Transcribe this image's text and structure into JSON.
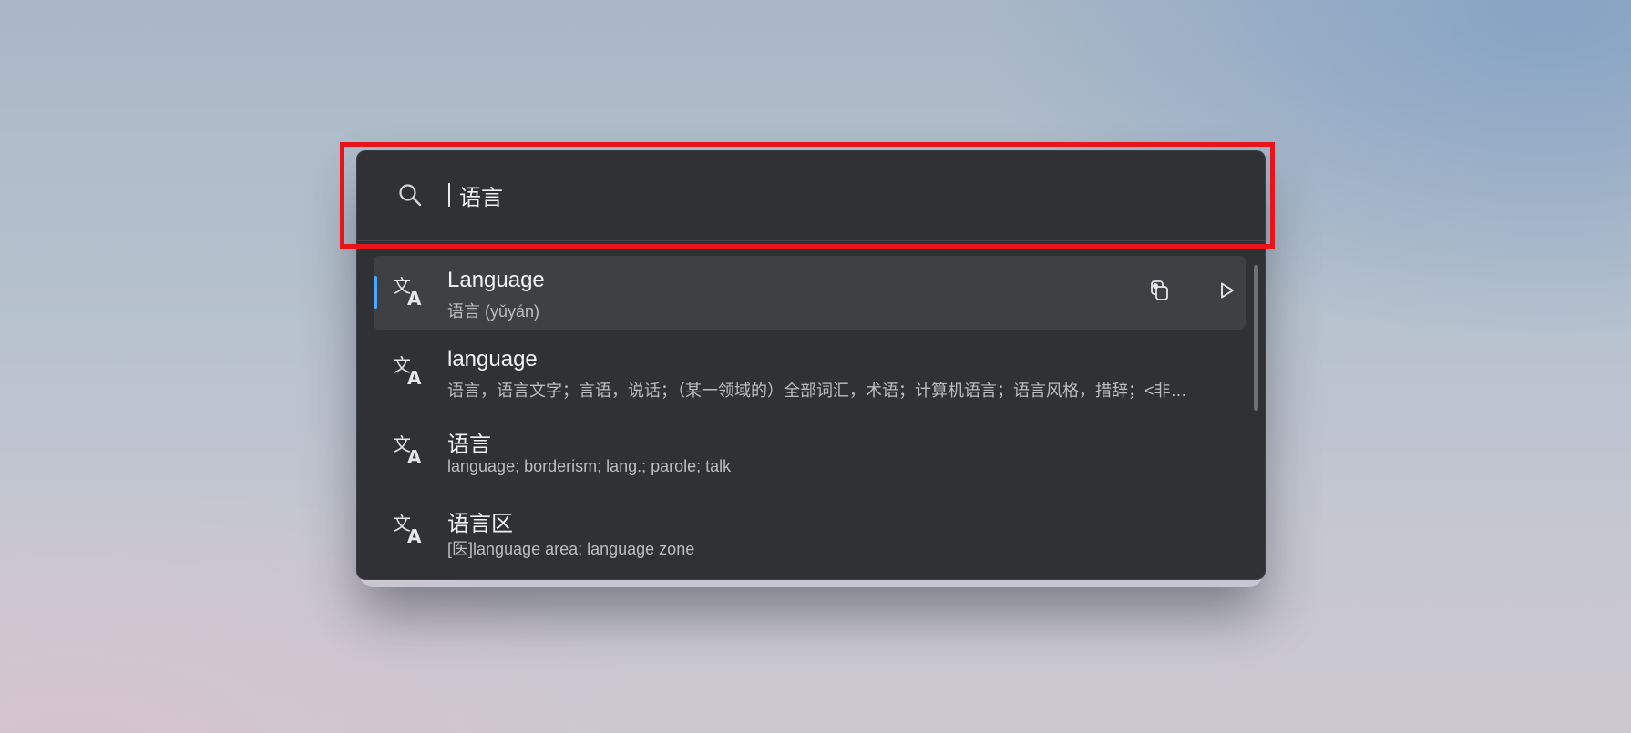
{
  "search": {
    "query": "语言",
    "icon": "search-icon"
  },
  "results": [
    {
      "icon": "translate-icon",
      "title": "Language",
      "subtitle": "语言 (yǔyán)",
      "selected": true,
      "actions": [
        "copy-icon",
        "play-icon"
      ]
    },
    {
      "icon": "translate-icon",
      "title": "language",
      "subtitle": "语言，语言文字；言语，说话；（某一领域的）全部词汇，术语；计算机语言；语言风格，措辞；<非…",
      "selected": false
    },
    {
      "icon": "translate-icon",
      "title": "语言",
      "subtitle": "language; borderism; lang.; parole; talk",
      "selected": false
    },
    {
      "icon": "translate-icon",
      "title": "语言区",
      "subtitle": "[医]language area; language zone",
      "selected": false
    }
  ],
  "colors": {
    "panel_bg": "#2f3134",
    "selected_bg": "#3e4044",
    "accent": "#4aa8ff",
    "highlight_frame": "#e8141c"
  }
}
